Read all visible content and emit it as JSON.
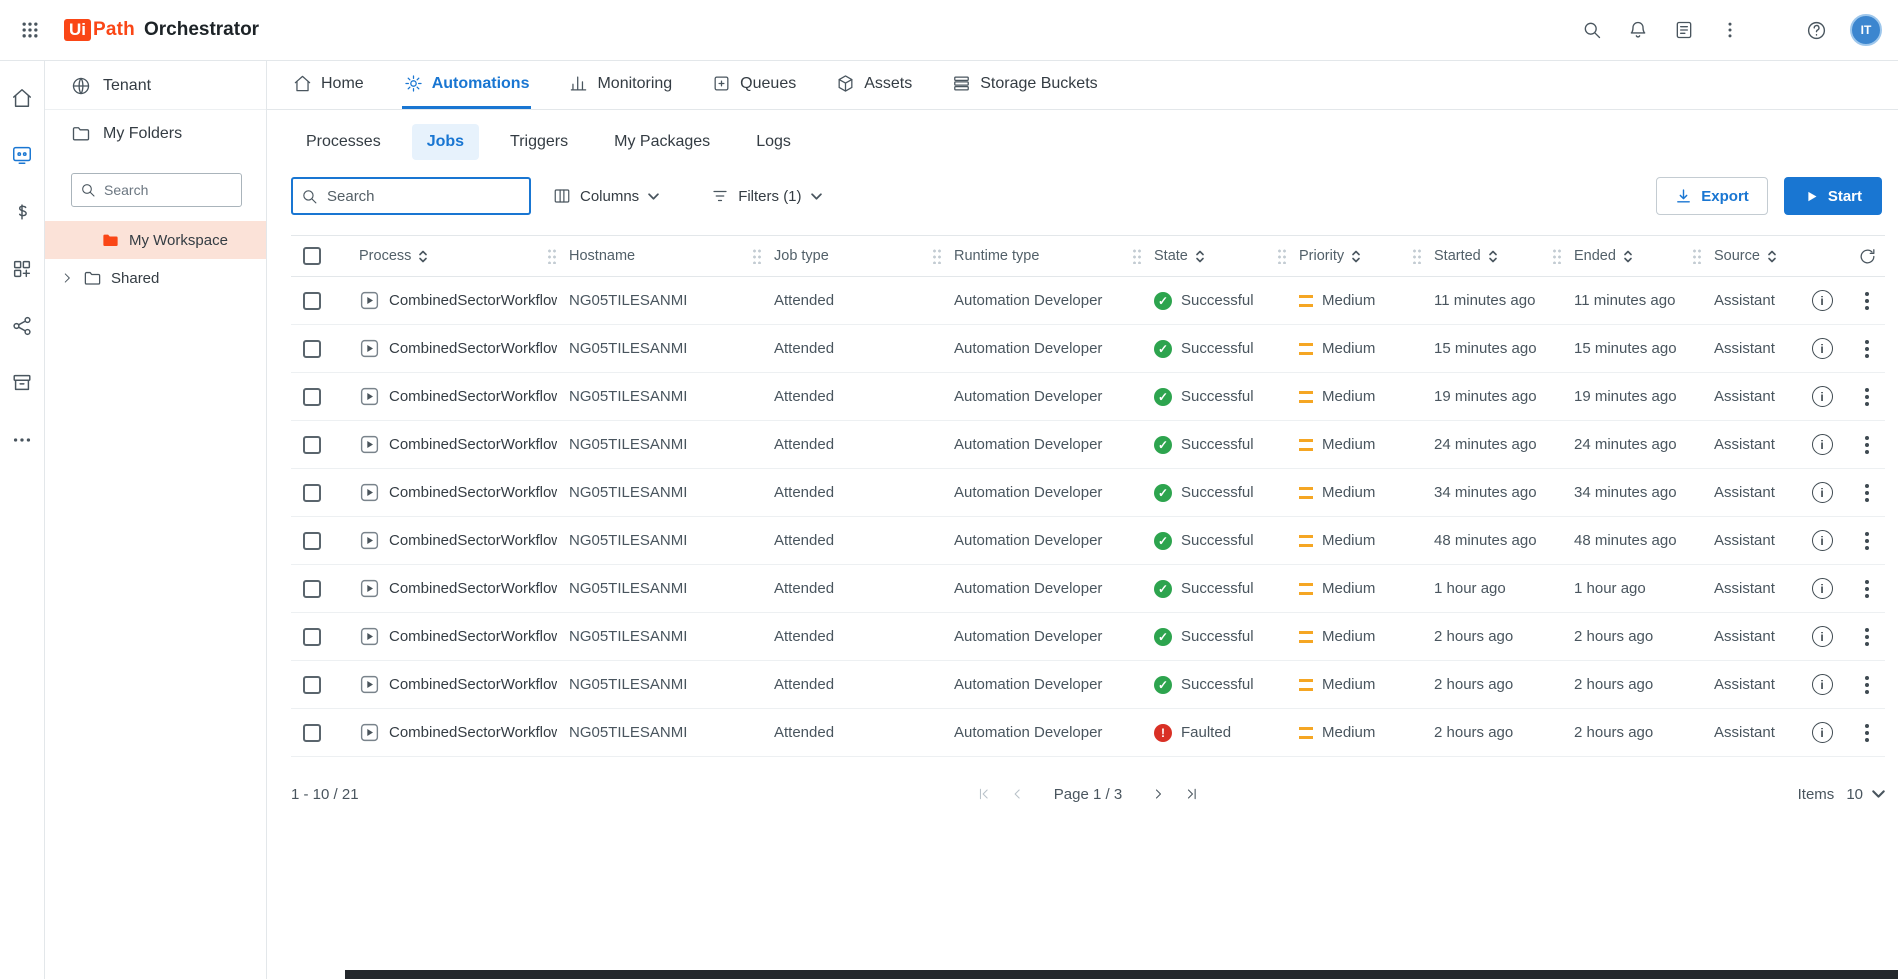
{
  "colors": {
    "accent": "#1976d2",
    "brand_orange": "#fa4616",
    "success": "#2da44e",
    "fault": "#d93025",
    "priority": "#f5a623",
    "workspace_bg": "#fbe2d8"
  },
  "topbar": {
    "logo_ui": "Ui",
    "logo_path": "Path",
    "product": "Orchestrator",
    "avatar_initials": "IT"
  },
  "sidebar": {
    "tenant": "Tenant",
    "my_folders": "My Folders",
    "search_placeholder": "Search",
    "workspace": "My Workspace",
    "shared": "Shared"
  },
  "tabs": {
    "home": "Home",
    "automations": "Automations",
    "monitoring": "Monitoring",
    "queues": "Queues",
    "assets": "Assets",
    "storage_buckets": "Storage Buckets"
  },
  "subtabs": {
    "processes": "Processes",
    "jobs": "Jobs",
    "triggers": "Triggers",
    "my_packages": "My Packages",
    "logs": "Logs"
  },
  "toolbar": {
    "search_placeholder": "Search",
    "columns": "Columns",
    "filters": "Filters (1)",
    "export": "Export",
    "start": "Start"
  },
  "table": {
    "headers": {
      "process": "Process",
      "hostname": "Hostname",
      "job_type": "Job type",
      "runtime_type": "Runtime type",
      "state": "State",
      "priority": "Priority",
      "started": "Started",
      "ended": "Ended",
      "source": "Source"
    },
    "rows": [
      {
        "process": "CombinedSectorWorkflow",
        "hostname": "NG05TILESANMI",
        "job_type": "Attended",
        "runtime_type": "Automation Developer",
        "state": "Successful",
        "priority": "Medium",
        "started": "11 minutes ago",
        "ended": "11 minutes ago",
        "source": "Assistant"
      },
      {
        "process": "CombinedSectorWorkflow",
        "hostname": "NG05TILESANMI",
        "job_type": "Attended",
        "runtime_type": "Automation Developer",
        "state": "Successful",
        "priority": "Medium",
        "started": "15 minutes ago",
        "ended": "15 minutes ago",
        "source": "Assistant"
      },
      {
        "process": "CombinedSectorWorkflow",
        "hostname": "NG05TILESANMI",
        "job_type": "Attended",
        "runtime_type": "Automation Developer",
        "state": "Successful",
        "priority": "Medium",
        "started": "19 minutes ago",
        "ended": "19 minutes ago",
        "source": "Assistant"
      },
      {
        "process": "CombinedSectorWorkflow",
        "hostname": "NG05TILESANMI",
        "job_type": "Attended",
        "runtime_type": "Automation Developer",
        "state": "Successful",
        "priority": "Medium",
        "started": "24 minutes ago",
        "ended": "24 minutes ago",
        "source": "Assistant"
      },
      {
        "process": "CombinedSectorWorkflow",
        "hostname": "NG05TILESANMI",
        "job_type": "Attended",
        "runtime_type": "Automation Developer",
        "state": "Successful",
        "priority": "Medium",
        "started": "34 minutes ago",
        "ended": "34 minutes ago",
        "source": "Assistant"
      },
      {
        "process": "CombinedSectorWorkflow",
        "hostname": "NG05TILESANMI",
        "job_type": "Attended",
        "runtime_type": "Automation Developer",
        "state": "Successful",
        "priority": "Medium",
        "started": "48 minutes ago",
        "ended": "48 minutes ago",
        "source": "Assistant"
      },
      {
        "process": "CombinedSectorWorkflow",
        "hostname": "NG05TILESANMI",
        "job_type": "Attended",
        "runtime_type": "Automation Developer",
        "state": "Successful",
        "priority": "Medium",
        "started": "1 hour ago",
        "ended": "1 hour ago",
        "source": "Assistant"
      },
      {
        "process": "CombinedSectorWorkflow",
        "hostname": "NG05TILESANMI",
        "job_type": "Attended",
        "runtime_type": "Automation Developer",
        "state": "Successful",
        "priority": "Medium",
        "started": "2 hours ago",
        "ended": "2 hours ago",
        "source": "Assistant"
      },
      {
        "process": "CombinedSectorWorkflow",
        "hostname": "NG05TILESANMI",
        "job_type": "Attended",
        "runtime_type": "Automation Developer",
        "state": "Successful",
        "priority": "Medium",
        "started": "2 hours ago",
        "ended": "2 hours ago",
        "source": "Assistant"
      },
      {
        "process": "CombinedSectorWorkflow",
        "hostname": "NG05TILESANMI",
        "job_type": "Attended",
        "runtime_type": "Automation Developer",
        "state": "Faulted",
        "priority": "Medium",
        "started": "2 hours ago",
        "ended": "2 hours ago",
        "source": "Assistant"
      }
    ]
  },
  "pagination": {
    "range": "1 - 10 / 21",
    "page": "Page 1 / 3",
    "items_label": "Items",
    "page_size": "10"
  }
}
